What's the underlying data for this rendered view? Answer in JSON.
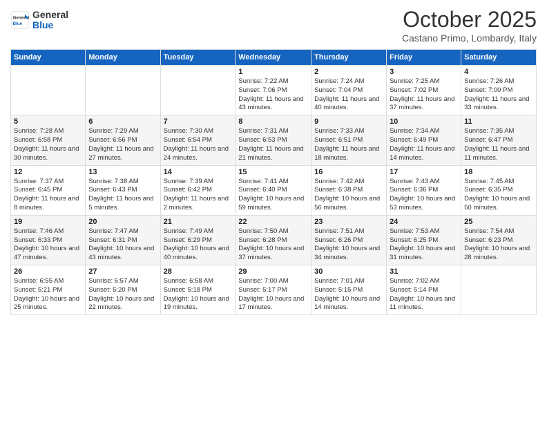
{
  "logo": {
    "general": "General",
    "blue": "Blue"
  },
  "title": "October 2025",
  "subtitle": "Castano Primo, Lombardy, Italy",
  "days_of_week": [
    "Sunday",
    "Monday",
    "Tuesday",
    "Wednesday",
    "Thursday",
    "Friday",
    "Saturday"
  ],
  "weeks": [
    [
      {
        "day": "",
        "info": ""
      },
      {
        "day": "",
        "info": ""
      },
      {
        "day": "",
        "info": ""
      },
      {
        "day": "1",
        "info": "Sunrise: 7:22 AM\nSunset: 7:06 PM\nDaylight: 11 hours and 43 minutes."
      },
      {
        "day": "2",
        "info": "Sunrise: 7:24 AM\nSunset: 7:04 PM\nDaylight: 11 hours and 40 minutes."
      },
      {
        "day": "3",
        "info": "Sunrise: 7:25 AM\nSunset: 7:02 PM\nDaylight: 11 hours and 37 minutes."
      },
      {
        "day": "4",
        "info": "Sunrise: 7:26 AM\nSunset: 7:00 PM\nDaylight: 11 hours and 33 minutes."
      }
    ],
    [
      {
        "day": "5",
        "info": "Sunrise: 7:28 AM\nSunset: 6:58 PM\nDaylight: 11 hours and 30 minutes."
      },
      {
        "day": "6",
        "info": "Sunrise: 7:29 AM\nSunset: 6:56 PM\nDaylight: 11 hours and 27 minutes."
      },
      {
        "day": "7",
        "info": "Sunrise: 7:30 AM\nSunset: 6:54 PM\nDaylight: 11 hours and 24 minutes."
      },
      {
        "day": "8",
        "info": "Sunrise: 7:31 AM\nSunset: 6:53 PM\nDaylight: 11 hours and 21 minutes."
      },
      {
        "day": "9",
        "info": "Sunrise: 7:33 AM\nSunset: 6:51 PM\nDaylight: 11 hours and 18 minutes."
      },
      {
        "day": "10",
        "info": "Sunrise: 7:34 AM\nSunset: 6:49 PM\nDaylight: 11 hours and 14 minutes."
      },
      {
        "day": "11",
        "info": "Sunrise: 7:35 AM\nSunset: 6:47 PM\nDaylight: 11 hours and 11 minutes."
      }
    ],
    [
      {
        "day": "12",
        "info": "Sunrise: 7:37 AM\nSunset: 6:45 PM\nDaylight: 11 hours and 8 minutes."
      },
      {
        "day": "13",
        "info": "Sunrise: 7:38 AM\nSunset: 6:43 PM\nDaylight: 11 hours and 5 minutes."
      },
      {
        "day": "14",
        "info": "Sunrise: 7:39 AM\nSunset: 6:42 PM\nDaylight: 11 hours and 2 minutes."
      },
      {
        "day": "15",
        "info": "Sunrise: 7:41 AM\nSunset: 6:40 PM\nDaylight: 10 hours and 59 minutes."
      },
      {
        "day": "16",
        "info": "Sunrise: 7:42 AM\nSunset: 6:38 PM\nDaylight: 10 hours and 56 minutes."
      },
      {
        "day": "17",
        "info": "Sunrise: 7:43 AM\nSunset: 6:36 PM\nDaylight: 10 hours and 53 minutes."
      },
      {
        "day": "18",
        "info": "Sunrise: 7:45 AM\nSunset: 6:35 PM\nDaylight: 10 hours and 50 minutes."
      }
    ],
    [
      {
        "day": "19",
        "info": "Sunrise: 7:46 AM\nSunset: 6:33 PM\nDaylight: 10 hours and 47 minutes."
      },
      {
        "day": "20",
        "info": "Sunrise: 7:47 AM\nSunset: 6:31 PM\nDaylight: 10 hours and 43 minutes."
      },
      {
        "day": "21",
        "info": "Sunrise: 7:49 AM\nSunset: 6:29 PM\nDaylight: 10 hours and 40 minutes."
      },
      {
        "day": "22",
        "info": "Sunrise: 7:50 AM\nSunset: 6:28 PM\nDaylight: 10 hours and 37 minutes."
      },
      {
        "day": "23",
        "info": "Sunrise: 7:51 AM\nSunset: 6:26 PM\nDaylight: 10 hours and 34 minutes."
      },
      {
        "day": "24",
        "info": "Sunrise: 7:53 AM\nSunset: 6:25 PM\nDaylight: 10 hours and 31 minutes."
      },
      {
        "day": "25",
        "info": "Sunrise: 7:54 AM\nSunset: 6:23 PM\nDaylight: 10 hours and 28 minutes."
      }
    ],
    [
      {
        "day": "26",
        "info": "Sunrise: 6:55 AM\nSunset: 5:21 PM\nDaylight: 10 hours and 25 minutes."
      },
      {
        "day": "27",
        "info": "Sunrise: 6:57 AM\nSunset: 5:20 PM\nDaylight: 10 hours and 22 minutes."
      },
      {
        "day": "28",
        "info": "Sunrise: 6:58 AM\nSunset: 5:18 PM\nDaylight: 10 hours and 19 minutes."
      },
      {
        "day": "29",
        "info": "Sunrise: 7:00 AM\nSunset: 5:17 PM\nDaylight: 10 hours and 17 minutes."
      },
      {
        "day": "30",
        "info": "Sunrise: 7:01 AM\nSunset: 5:15 PM\nDaylight: 10 hours and 14 minutes."
      },
      {
        "day": "31",
        "info": "Sunrise: 7:02 AM\nSunset: 5:14 PM\nDaylight: 10 hours and 11 minutes."
      },
      {
        "day": "",
        "info": ""
      }
    ]
  ]
}
